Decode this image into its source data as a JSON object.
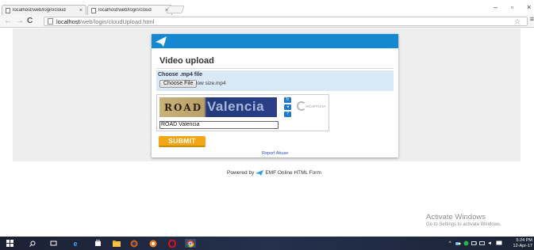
{
  "browser": {
    "tabs": [
      {
        "label": "localhost/web/login/cloud",
        "active": false
      },
      {
        "label": "localhost/web/login/cloud",
        "active": true
      }
    ],
    "url_host": "localhost",
    "url_path": "/web/login/cloudUpload.html"
  },
  "form": {
    "title": "Video upload",
    "upload_label": "Choose .mp4 file",
    "choose_file_label": "Choose File",
    "file_name": "low size.mp4",
    "captcha_word1": "ROAD",
    "captcha_word2": "Valencia",
    "recaptcha_text": "reCAPTCHA",
    "captcha_input_value": "ROAD Valencia",
    "submit_label": "SUBMIT",
    "report_abuse": "Report Abuse",
    "header_color": "#1489d1",
    "submit_color": "#f3a716"
  },
  "footer": {
    "powered_prefix": "Powered by",
    "powered_suffix": "EMF Online HTML Form"
  },
  "watermark": {
    "title": "Activate Windows",
    "subtitle": "Go to Settings to activate Windows."
  },
  "taskbar": {
    "time": "5:24 PM",
    "date": "12-Apr-17"
  }
}
